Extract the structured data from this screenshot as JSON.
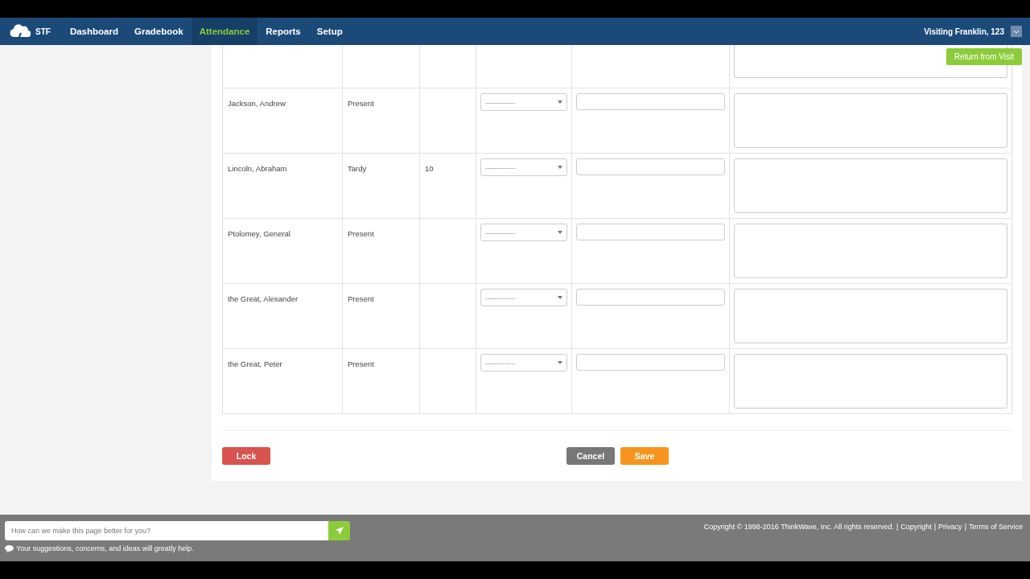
{
  "nav": {
    "brand": "STF",
    "items": [
      {
        "label": "Dashboard",
        "selected": false
      },
      {
        "label": "Gradebook",
        "selected": false
      },
      {
        "label": "Attendance",
        "selected": true
      },
      {
        "label": "Reports",
        "selected": false
      },
      {
        "label": "Setup",
        "selected": false
      }
    ],
    "user": "Visiting Franklin, 123"
  },
  "return_button": "Return from Visit",
  "rows": [
    {
      "name": "Jackson, Andrew",
      "status": "Present",
      "minutes": "",
      "reason": "--------------"
    },
    {
      "name": "Lincoln, Abraham",
      "status": "Tardy",
      "minutes": "10",
      "reason": "--------------"
    },
    {
      "name": "Ptolomey, General",
      "status": "Present",
      "minutes": "",
      "reason": "--------------"
    },
    {
      "name": "the Great, Alexander",
      "status": "Present",
      "minutes": "",
      "reason": "--------------"
    },
    {
      "name": "the Great, Peter",
      "status": "Present",
      "minutes": "",
      "reason": "--------------"
    }
  ],
  "buttons": {
    "lock": "Lock",
    "cancel": "Cancel",
    "save": "Save"
  },
  "footer": {
    "feedback": {
      "placeholder": "How can we make this page better for you?"
    },
    "hint": "Your suggestions, concerns, and ideas will greatly help.",
    "copyright": "Copyright © 1998-2016 ThinkWave, Inc. All rights reserved.",
    "separator": "|",
    "links": [
      "Copyright",
      "Privacy",
      "Terms of Service"
    ]
  }
}
